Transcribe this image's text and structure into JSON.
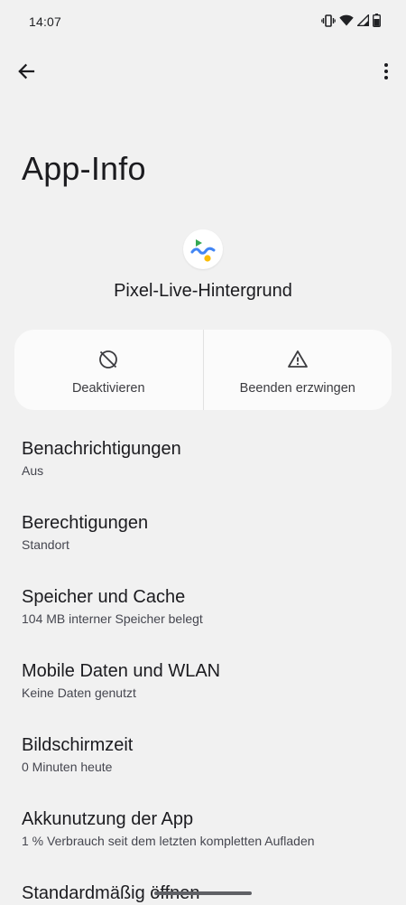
{
  "status_bar": {
    "time": "14:07",
    "icons": [
      "vibrate-icon",
      "wifi-icon",
      "signal-icon",
      "battery-icon"
    ]
  },
  "toolbar": {
    "back_icon": "arrow-back-icon",
    "more_icon": "more-vert-icon"
  },
  "page": {
    "title": "App-Info"
  },
  "app": {
    "name": "Pixel-Live-Hintergrund",
    "icon": "pixel-live-wallpaper-icon"
  },
  "actions": [
    {
      "label": "Deaktivieren",
      "icon": "disable-icon"
    },
    {
      "label": "Beenden erzwingen",
      "icon": "warning-icon"
    }
  ],
  "settings": [
    {
      "title": "Benachrichtigungen",
      "summary": "Aus"
    },
    {
      "title": "Berechtigungen",
      "summary": "Standort"
    },
    {
      "title": "Speicher und Cache",
      "summary": "104 MB interner Speicher belegt"
    },
    {
      "title": "Mobile Daten und WLAN",
      "summary": "Keine Daten genutzt"
    },
    {
      "title": "Bildschirmzeit",
      "summary": "0 Minuten heute"
    },
    {
      "title": "Akkunutzung der App",
      "summary": "1 % Verbrauch seit dem letzten kompletten Aufladen"
    },
    {
      "title": "Standardmäßig öffnen",
      "summary": ""
    }
  ],
  "colors": {
    "background": "#f1f1f1",
    "card": "#fbfbfb",
    "text_primary": "#1b1b1f",
    "text_secondary": "#45464f",
    "logo_green": "#34a853",
    "logo_blue": "#4285f4",
    "logo_yellow": "#fbbc04"
  }
}
